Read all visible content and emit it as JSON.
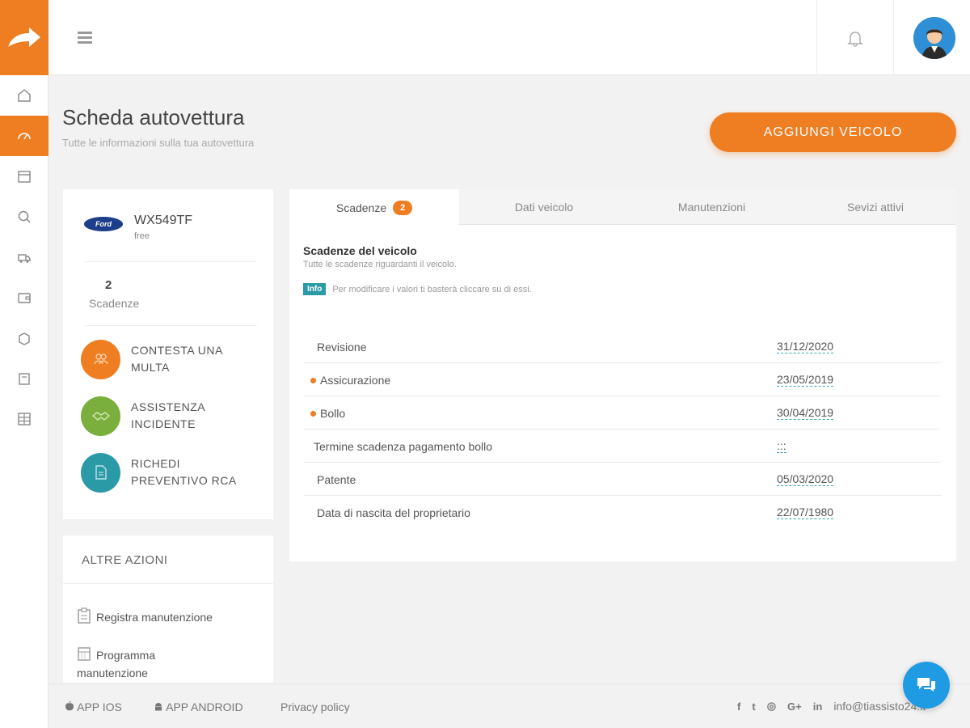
{
  "colors": {
    "accent": "#ef7d22",
    "teal": "#2a9aa7",
    "green": "#7aae3d",
    "chat": "#1e9be3"
  },
  "sidebar": {
    "logo_icon": "arrow-forward-icon",
    "items": [
      {
        "icon": "home-icon"
      },
      {
        "icon": "speedometer-icon",
        "active": true
      },
      {
        "icon": "calendar-icon"
      },
      {
        "icon": "search-icon"
      },
      {
        "icon": "truck-icon"
      },
      {
        "icon": "wallet-icon"
      },
      {
        "icon": "box-icon"
      },
      {
        "icon": "note-icon"
      },
      {
        "icon": "grid-icon"
      }
    ]
  },
  "header": {
    "menu_icon": "menu-icon",
    "bell_icon": "bell-icon"
  },
  "page": {
    "title": "Scheda autovettura",
    "subtitle": "Tutte le informazioni sulla tua autovettura",
    "add_button": "AGGIUNGI VEICOLO"
  },
  "vehicle": {
    "brand": "Ford",
    "plate": "WX549TF",
    "plan": "free",
    "deadlines_count": "2",
    "deadlines_label": "Scadenze"
  },
  "actions": [
    {
      "label": "CONTESTA UNA MULTA",
      "icon": "people-icon"
    },
    {
      "label": "ASSISTENZA INCIDENTE",
      "icon": "handshake-icon"
    },
    {
      "label": "RICHEDI PREVENTIVO RCA",
      "icon": "document-icon"
    }
  ],
  "other_actions": {
    "title": "ALTRE AZIONI",
    "items": [
      {
        "label": "Registra manutenzione",
        "icon": "clipboard-icon"
      },
      {
        "label": "Programma manutenzione",
        "icon": "calendar-icon"
      }
    ]
  },
  "tabs": [
    {
      "label": "Scadenze",
      "badge": "2",
      "active": true
    },
    {
      "label": "Dati veicolo"
    },
    {
      "label": "Manutenzioni"
    },
    {
      "label": "Sevizi attivi"
    }
  ],
  "deadlines_section": {
    "title": "Scadenze del veicolo",
    "subtitle": "Tutte le scadenze riguardanti il veicolo.",
    "info_badge": "Info",
    "info_text": "Per modificare i valori ti basterà cliccare su di essi."
  },
  "deadlines": [
    {
      "label": "Revisione",
      "value": "31/12/2020",
      "flag": false
    },
    {
      "label": "Assicurazione",
      "value": "23/05/2019",
      "flag": true
    },
    {
      "label": "Bollo",
      "value": "30/04/2019",
      "flag": true
    },
    {
      "label": "Termine scadenza pagamento bollo",
      "value": ":::",
      "flag": false
    },
    {
      "label": "Patente",
      "value": "05/03/2020",
      "flag": false
    },
    {
      "label": "Data di nascita del proprietario",
      "value": "22/07/1980",
      "flag": false
    }
  ],
  "footer": {
    "app_ios": "APP IOS",
    "app_android": "APP ANDROID",
    "privacy": "Privacy policy",
    "socials": [
      "facebook-icon",
      "twitter-icon",
      "instagram-icon",
      "google-plus-icon",
      "linkedin-icon"
    ],
    "email": "info@tiassisto24.it"
  },
  "chat_icon": "chat-icon"
}
